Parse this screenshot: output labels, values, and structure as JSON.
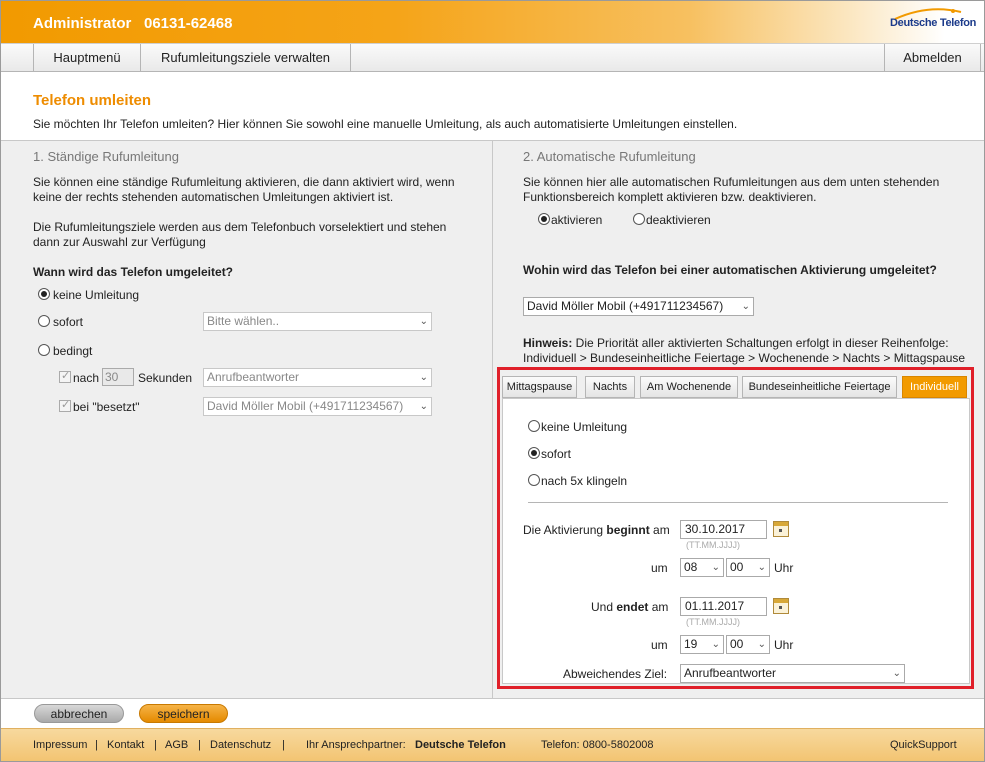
{
  "header": {
    "admin": "Administrator",
    "phone": "06131-62468",
    "logo": "Deutsche Telefon"
  },
  "nav": {
    "hauptmenu": "Hauptmenü",
    "ziele": "Rufumleitungsziele verwalten",
    "abmelden": "Abmelden"
  },
  "page": {
    "title": "Telefon umleiten",
    "intro": "Sie möchten Ihr Telefon umleiten? Hier können Sie sowohl eine manuelle Umleitung, als auch automatisierte Umleitungen einstellen."
  },
  "left": {
    "title": "1. Ständige Rufumleitung",
    "desc1_line1": "Sie können eine ständige Rufumleitung aktivieren, die dann aktiviert wird, wenn",
    "desc1_line2": "keine der rechts stehenden automatischen Umleitungen aktiviert ist.",
    "desc2_line1": "Die Rufumleitungsziele werden aus dem Telefonbuch vorselektiert und stehen",
    "desc2_line2": "dann zur Auswahl zur Verfügung",
    "question": "Wann wird das Telefon umgeleitet?",
    "opt_none": "keine Umleitung",
    "opt_sofort": "sofort",
    "opt_bedingt": "bedingt",
    "select_sofort": "Bitte wählen..",
    "nach_label": "nach",
    "nach_value": "30",
    "sekunden": "Sekunden",
    "select_nach": "Anrufbeantworter",
    "besetzt_label": "bei \"besetzt\"",
    "select_besetzt": "David Möller Mobil (+491711234567)"
  },
  "right": {
    "title": "2. Automatische Rufumleitung",
    "desc_line1": "Sie können hier alle automatischen Rufumleitungen aus dem unten stehenden",
    "desc_line2": "Funktionsbereich komplett aktivieren bzw. deaktivieren.",
    "aktivieren": "aktivieren",
    "deaktivieren": "deaktivieren",
    "question": "Wohin wird das Telefon bei einer automatischen Aktivierung umgeleitet?",
    "select_target": "David Möller Mobil (+491711234567)",
    "hint_label": "Hinweis:",
    "hint_text": " Die Priorität aller aktivierten Schaltungen erfolgt in dieser Reihenfolge:",
    "hint_order": "Individuell > Bundeseinheitliche Feiertage > Wochenende > Nachts > Mittagspause",
    "tabs": [
      "Mittagspause",
      "Nachts",
      "Am Wochenende",
      "Bundeseinheitliche Feiertage",
      "Individuell"
    ],
    "tab_opt_none": "keine Umleitung",
    "tab_opt_sofort": "sofort",
    "tab_opt_nach": "nach 5x klingeln",
    "begin_prefix": "Die Aktivierung ",
    "begin_bold": "beginnt",
    "begin_suffix": " am",
    "begin_date": "30.10.2017",
    "date_format": "(TT.MM.JJJJ)",
    "um": "um",
    "begin_hour": "08",
    "begin_min": "00",
    "uhr": "Uhr",
    "end_prefix": "Und ",
    "end_bold": "endet",
    "end_suffix": " am",
    "end_date": "01.11.2017",
    "end_hour": "19",
    "end_min": "00",
    "alt_label": "Abweichendes Ziel:",
    "alt_target": "Anrufbeantworter"
  },
  "buttons": {
    "cancel": "abbrechen",
    "save": "speichern"
  },
  "footer": {
    "impressum": "Impressum",
    "kontakt": "Kontakt",
    "agb": "AGB",
    "datenschutz": "Datenschutz",
    "sep": "|",
    "partner_label": "Ihr Ansprechpartner:",
    "partner_name": "Deutsche Telefon",
    "telefon": "Telefon: 0800-5802008",
    "quicksupport": "QuickSupport"
  }
}
